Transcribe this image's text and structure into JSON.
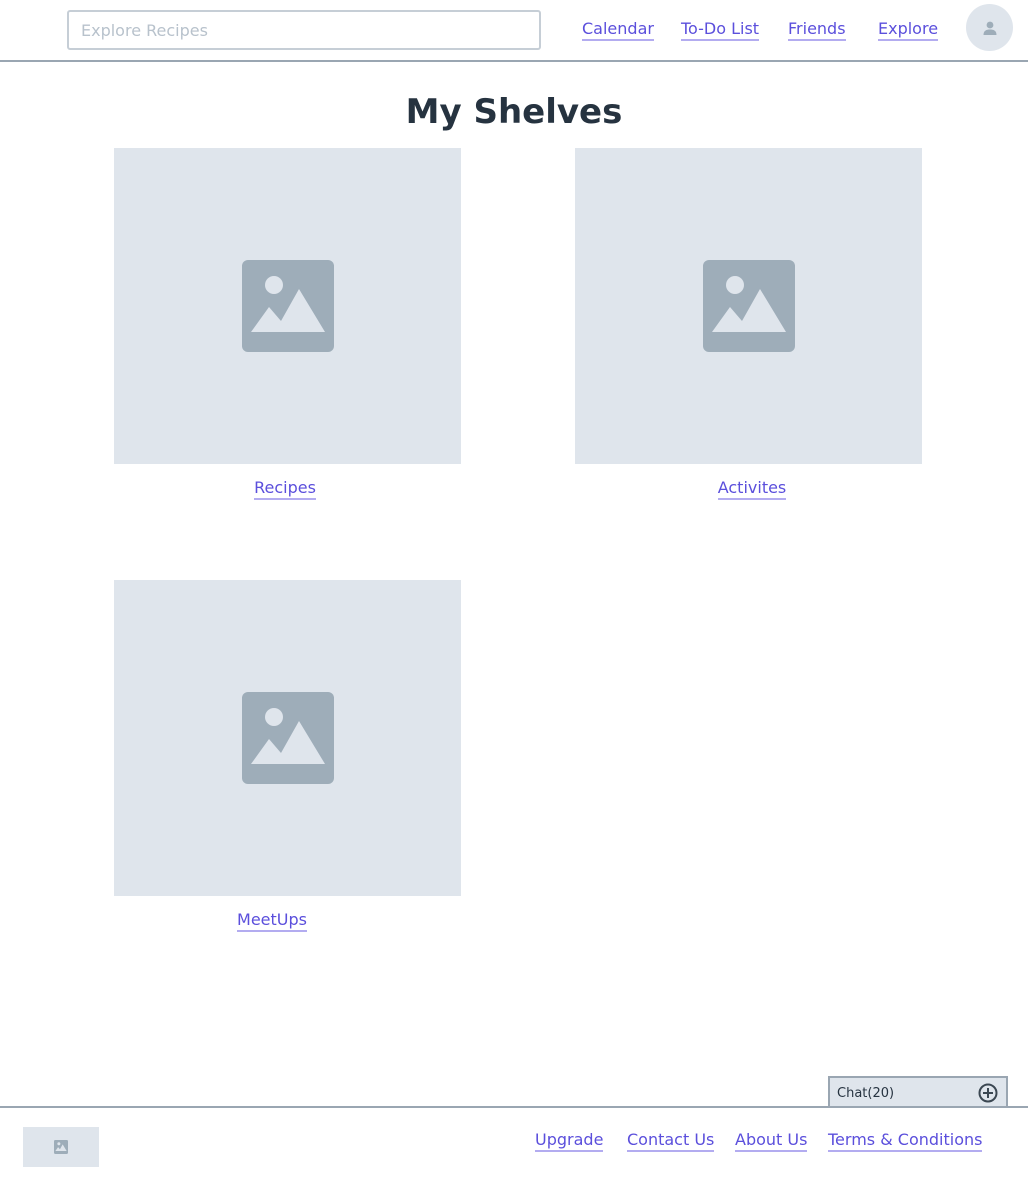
{
  "header": {
    "search": {
      "placeholder": "Explore Recipes",
      "value": ""
    },
    "nav": [
      {
        "label": "Calendar"
      },
      {
        "label": "To-Do List"
      },
      {
        "label": "Friends"
      },
      {
        "label": "Explore"
      }
    ],
    "avatar_icon": "user-icon"
  },
  "main": {
    "title": "My Shelves",
    "shelves": [
      {
        "label": "Recipes",
        "icon": "image-placeholder-icon"
      },
      {
        "label": "Activites",
        "icon": "image-placeholder-icon"
      },
      {
        "label": "MeetUps",
        "icon": "image-placeholder-icon"
      }
    ]
  },
  "chat": {
    "label": "Chat(20)",
    "icon": "plus-circle-icon"
  },
  "footer": {
    "logo_icon": "image-placeholder-icon",
    "links": [
      {
        "label": "Upgrade"
      },
      {
        "label": "Contact Us"
      },
      {
        "label": "About Us"
      },
      {
        "label": "Terms & Conditions"
      }
    ]
  },
  "colors": {
    "link": "#5b4fdc",
    "placeholder_fill": "#dfe5ec",
    "icon_fill": "#9eadb9",
    "heading": "#263340",
    "border": "#9aa6b2"
  }
}
